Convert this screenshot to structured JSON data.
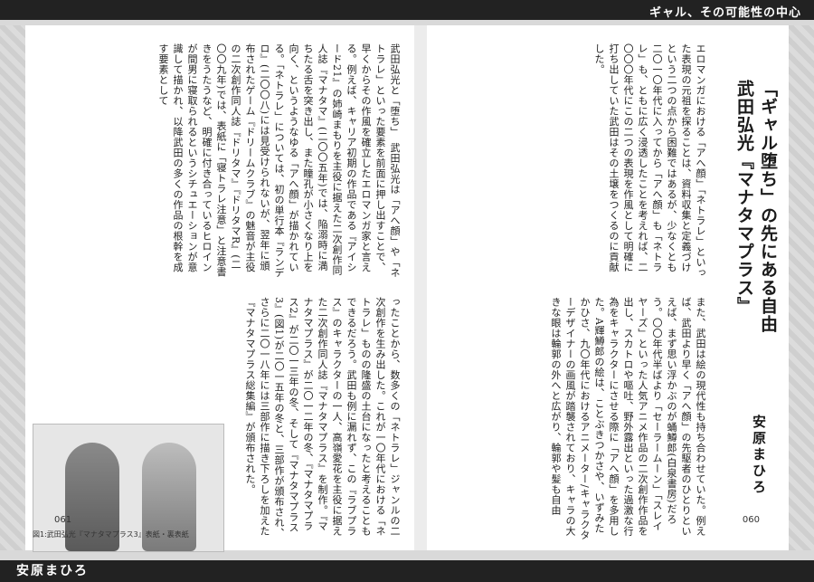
{
  "header": {
    "section_title": "ギャル、その可能性の中心"
  },
  "footer": {
    "author": "安原まひろ"
  },
  "pages": {
    "left_number": "061",
    "right_number": "060"
  },
  "article": {
    "title": "「ギャル堕ち」の先にある自由　武田弘光『マナタマプラス』",
    "author": "安原まひろ",
    "right_top": "エロマンガにおける「アへ顔」「ネトラレ」といった表現の元祖を探ることは、資料収集と定義づけという二つの点から困難ではあるが、少なくとも二〇一〇年代に入ってから「アへ顔」も「ネトラレ」も、ともに広く浸透したことを考えれば、二〇〇〇年代にこの二つの表現を作風として明確に打ち出していた武田はその土壌をつくるのに貢献した。",
    "right_bottom": "また、武田は絵の現代性も持ち合わせていた。例えば、武田より早く「アへ顔」の先駆者のひとりといえば、まず思い浮かぶのが蛹鱒郎(白泉書房)だろう。〇〇年代半ばより「セーラームーン」「スレイヤーズ」といった人気アニメ作品の二次創作作品を出し、スカトロや嘔吐、野外露出といった過激な行為をキャラクターにさせる際に「アへ顔」を多用した。A輝鱒郎の絵は、ことぶきつかさや、いずみたかひさ、九〇年代におけるアニメーター/キャラクターデザイナーの画風が踏襲されており、キャラの大きな眼は輪郭の外へと広がり、輪郭や髪も自由",
    "left_top": "武田弘光と「堕ち」　武田弘光は「アへ顔」や「ネトラレ」といった要素を前面に押し出すことで、早くからその作風を確立したエロマンガ家と言える。例えば、キャリア初期の作品である『アイシード21』の姉崎まもりを主役に据えた二次創作同人誌『マナタマ』(二〇〇五年)では、陥溺時に満ちたる舌を突き出し、また瞳孔が小さくなり上を向く、というようなゆる「アへ顔」が描かれている。「ネトラレ」については、初の単行本『ランデロ』(二〇〇八)には見受けられないが、翌年に頒布されたゲーム『ドリームクラブ』の魅音が主役の二次創作同人誌『ドリタマ』『ドリタマR』(二〇〇九年)では、表紙に「寝トラレ注意」と注意書きをうたうなど、明確に付き合っているヒロインが間男に寝取られるというシチュエーションが意識して描かれ、以降武田の多くの作品の根幹を成す要素として",
    "left_bottom": "ったことから、数多くの「ネトラレ」ジャンルの二次創作を生み出した。これが一〇年代における「ネトラレ」ものの隆盛の土台になったと考えることもできるだろう。武田も例に漏れず、この『ラブプラス』のキャラクターの一人、高嶺愛花を主役に据えた二次創作同人誌『マナタマプラス』を制作。『マナタマプラス』が二〇一二年の冬、『マナタマプラス2』が二〇一三年の冬、そして『マナタマプラス3』(図1)が二〇一五年の冬と、三部作が頒布され、さらに二〇一八年には三部作に描き下ろしを加えた『マナタマプラス総集編』が頒布された。",
    "figure_caption": "図1:武田弘光『マナタマプラス3』表紙・裏表紙"
  }
}
